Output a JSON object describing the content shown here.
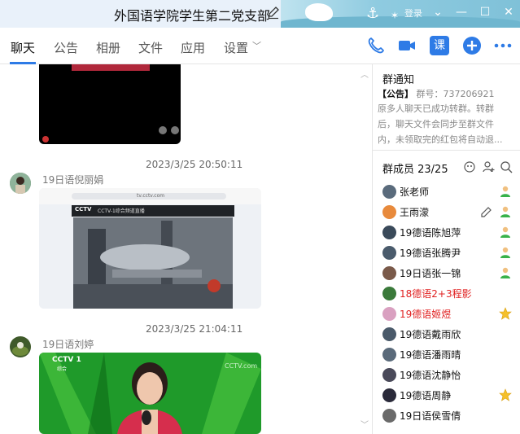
{
  "window": {
    "title": "外国语学院学生第二党支部",
    "banner_text": "登录"
  },
  "tabs": [
    {
      "label": "聊天",
      "active": true
    },
    {
      "label": "公告"
    },
    {
      "label": "相册"
    },
    {
      "label": "文件"
    },
    {
      "label": "应用"
    },
    {
      "label": "设置"
    }
  ],
  "toolbar": {
    "ke_label": "课"
  },
  "chat": {
    "messages": [
      {
        "timestamp": "2023/3/25 20:50:11",
        "sender": "19日语倪丽娟",
        "content": "image"
      },
      {
        "timestamp": "2023/3/25 21:04:11",
        "sender": "19日语刘婷",
        "content": "image"
      }
    ],
    "shot1": {
      "cctv_label": "CCTV",
      "channel_text": "CCTV-1综合频道直播",
      "url_text": "tv.cctv.com"
    },
    "shot2": {
      "logo": "CCTV 1",
      "logo_sub": "综合",
      "watermark": "CCTV.com"
    }
  },
  "notice": {
    "title": "群通知",
    "tag": "【公告】",
    "group_no": "群号：737206921",
    "lines": [
      "原多人聊天已成功转群。转群",
      "后，聊天文件会同步至群文件",
      "内，未领取完的红包将自动退..."
    ]
  },
  "members": {
    "title": "群成员 23/25",
    "list": [
      {
        "name": "张老师",
        "color": "#111111",
        "badge": "admin-green"
      },
      {
        "name": "王雨濛",
        "color": "#111111",
        "badge": "admin-green",
        "editable": true
      },
      {
        "name": "19德语陈旭萍",
        "color": "#111111",
        "badge": "admin-green"
      },
      {
        "name": "19德语张腾尹",
        "color": "#111111",
        "badge": "admin-green"
      },
      {
        "name": "19日语张一锦",
        "color": "#111111",
        "badge": "admin-green"
      },
      {
        "name": "18德语2+3程影",
        "color": "#e02020",
        "badge": "none"
      },
      {
        "name": "19德语姬煜",
        "color": "#e02020",
        "badge": "star"
      },
      {
        "name": "19德语戴雨欣",
        "color": "#111111",
        "badge": "none"
      },
      {
        "name": "19德语潘雨晴",
        "color": "#111111",
        "badge": "none"
      },
      {
        "name": "19德语沈静怡",
        "color": "#111111",
        "badge": "none"
      },
      {
        "name": "19德语周静",
        "color": "#111111",
        "badge": "star"
      },
      {
        "name": "19日语侯雪倩",
        "color": "#111111",
        "badge": "none"
      }
    ]
  },
  "colors": {
    "accent": "#2e7be6",
    "red_name": "#e02020",
    "title_bg": "#e9f1fa"
  }
}
